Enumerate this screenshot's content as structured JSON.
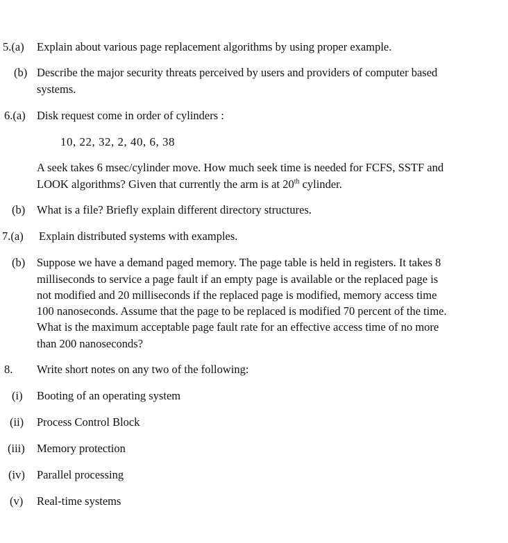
{
  "questions": {
    "q5a": {
      "num": "5.(a)",
      "text": "Explain about various page replacement algorithms by using proper example."
    },
    "q5b": {
      "num": "(b)",
      "lines": [
        "Describe the major security threats perceived by users and providers of computer based",
        "systems."
      ]
    },
    "q6a": {
      "num": "6.(a)",
      "text": "Disk request come in order of cylinders :",
      "sequence": "10,  22,  32,  2,  40,  6,  38",
      "line1": "A seek takes 6 msec/cylinder move. How much seek time is needed for FCFS, SSTF and",
      "line2_pre": "LOOK algorithms? Given that currently the arm is at 20",
      "line2_sup": "th",
      "line2_post": " cylinder."
    },
    "q6b": {
      "num": "(b)",
      "text": "What is a file? Briefly explain different directory structures."
    },
    "q7a": {
      "num": "7.(a)",
      "text": "Explain distributed systems with examples."
    },
    "q7b": {
      "num": "(b)",
      "lines": [
        "Suppose we have a demand paged memory. The page table is held in registers. It takes 8",
        "milliseconds to service a page fault if an empty page is available or the replaced page is",
        "not modified and 20 milliseconds if the replaced page is modified, memory access time",
        "100 nanoseconds. Assume that the page to be replaced is modified 70 percent of the time.",
        "What is the maximum acceptable page fault rate for an effective access time of no more",
        "than 200 nanoseconds?"
      ]
    },
    "q8": {
      "num": "8.",
      "text": "Write short notes on any two of the following:",
      "items": [
        {
          "num": "(i)",
          "text": "Booting of an operating system"
        },
        {
          "num": "(ii)",
          "text": "Process Control Block"
        },
        {
          "num": "(iii)",
          "text": "Memory protection"
        },
        {
          "num": "(iv)",
          "text": "Parallel processing"
        },
        {
          "num": "(v)",
          "text": "Real-time systems"
        }
      ]
    }
  }
}
